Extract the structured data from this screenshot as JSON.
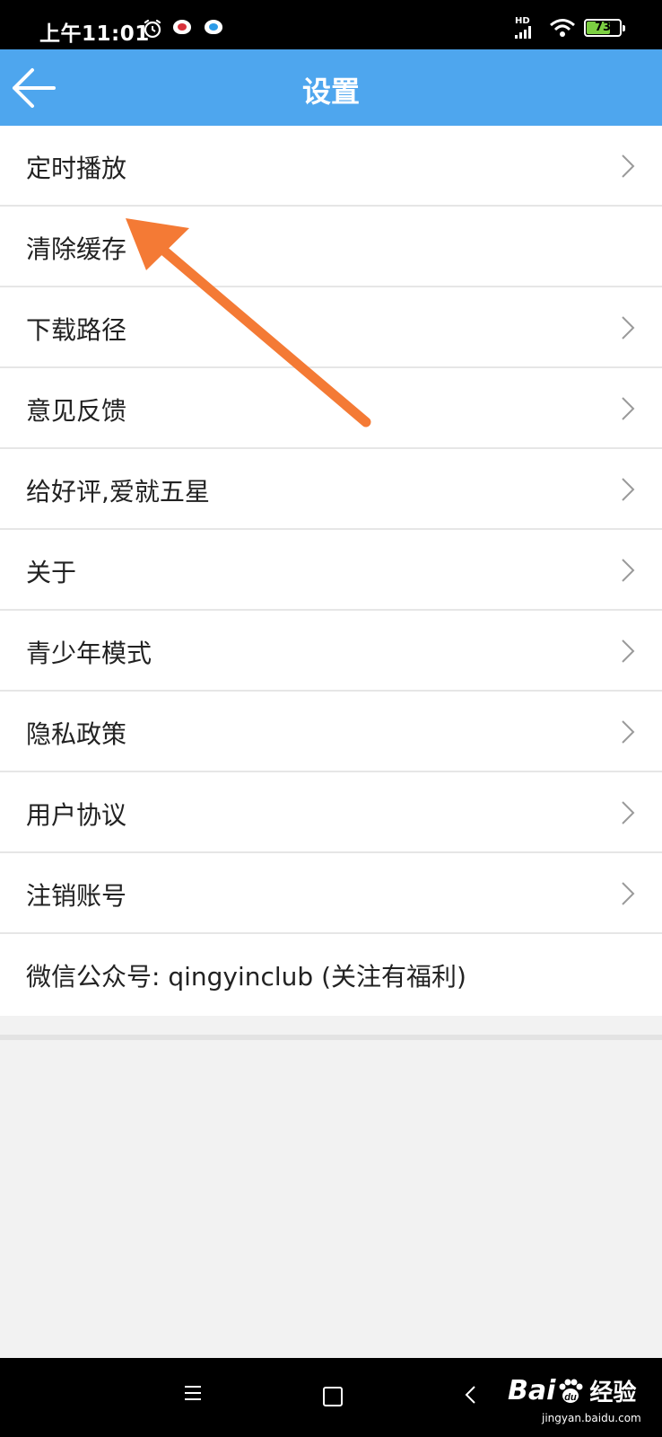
{
  "status_bar": {
    "time": "上午11:01",
    "network": "HD",
    "battery": "73",
    "battery_level": 0.73
  },
  "header": {
    "title": "设置"
  },
  "settings": [
    {
      "label": "定时播放",
      "has_chevron": true
    },
    {
      "label": "清除缓存",
      "has_chevron": false
    },
    {
      "label": "下载路径",
      "has_chevron": true
    },
    {
      "label": "意见反馈",
      "has_chevron": true
    },
    {
      "label": "给好评,爱就五星",
      "has_chevron": true
    },
    {
      "label": "关于",
      "has_chevron": true
    },
    {
      "label": "青少年模式",
      "has_chevron": true
    },
    {
      "label": "隐私政策",
      "has_chevron": true
    },
    {
      "label": "用户协议",
      "has_chevron": true
    },
    {
      "label": "注销账号",
      "has_chevron": true
    },
    {
      "label": "微信公众号: qingyinclub (关注有福利)",
      "has_chevron": false
    }
  ],
  "watermark": {
    "brand": "Bai",
    "brand_suffix": "du",
    "product": "经验",
    "url": "jingyan.baidu.com"
  },
  "colors": {
    "app_bar": "#4ea6ee",
    "annotation_arrow": "#f47a35",
    "page_background": "#f2f2f2"
  }
}
